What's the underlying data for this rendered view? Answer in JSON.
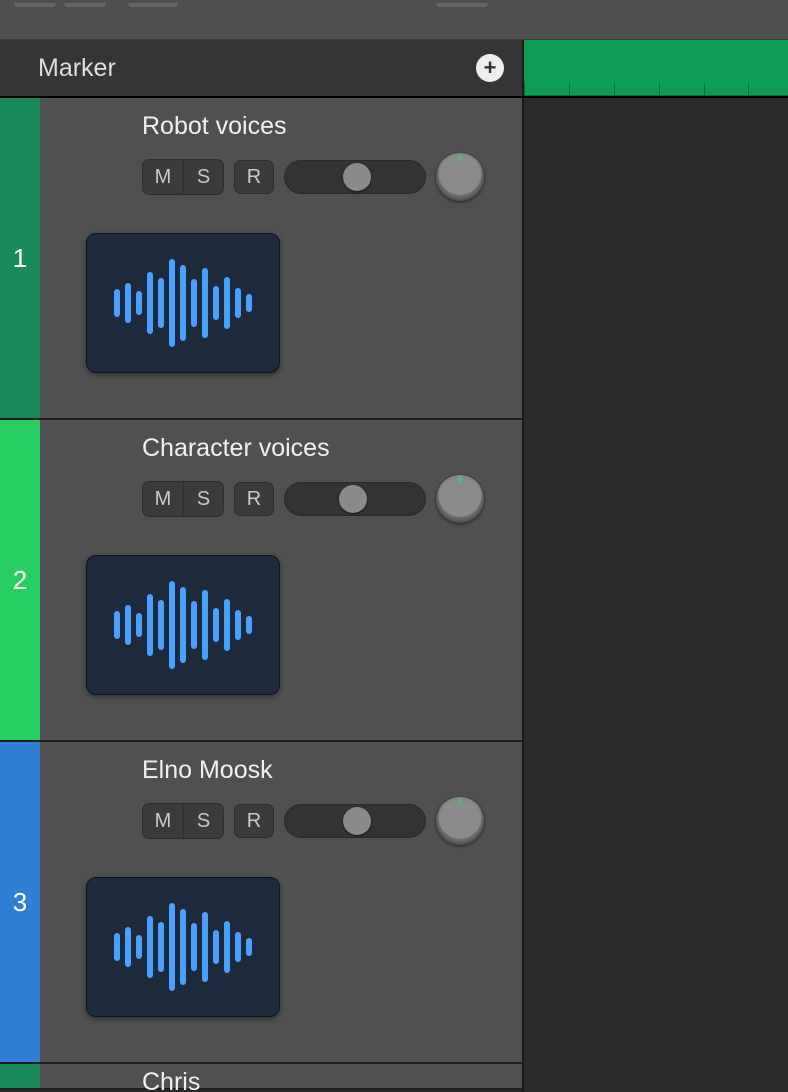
{
  "marker": {
    "label": "Marker"
  },
  "buttons": {
    "mute": "M",
    "solo": "S",
    "record": "R"
  },
  "tracks": [
    {
      "number": "1",
      "name": "Robot voices",
      "color": "#1a8a5a",
      "pan": 58
    },
    {
      "number": "2",
      "name": "Character voices",
      "color": "#27cf63",
      "pan": 54
    },
    {
      "number": "3",
      "name": "Elno Moosk",
      "color": "#2f7fd6",
      "pan": 58
    }
  ],
  "partialTrack": {
    "number": "",
    "name": "Chris",
    "color": "#1a8a5a"
  },
  "waveformBars": [
    28,
    40,
    24,
    62,
    50,
    88,
    76,
    48,
    70,
    34,
    52,
    30,
    18
  ],
  "rulerTicks": [
    0,
    0.17,
    0.34,
    0.51,
    0.68,
    0.85
  ]
}
